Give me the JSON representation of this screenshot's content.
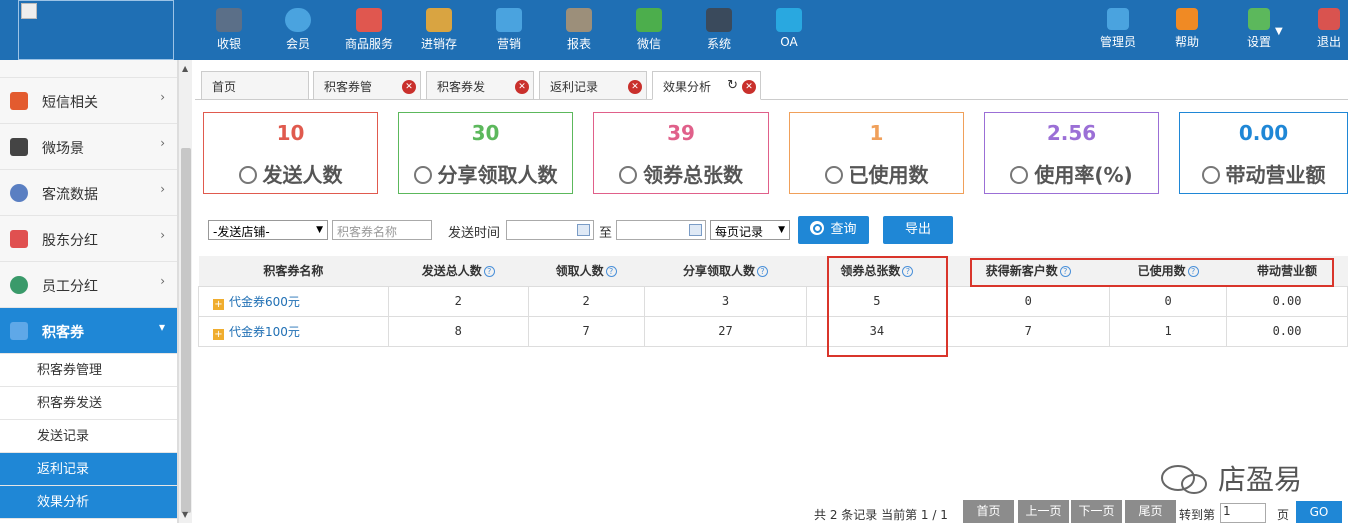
{
  "topnav": {
    "items": [
      {
        "label": "收银",
        "icon": "cash-register-icon",
        "color": "#5b6f88"
      },
      {
        "label": "会员",
        "icon": "member-icon",
        "color": "#4aa3df"
      },
      {
        "label": "商品服务",
        "icon": "goods-icon",
        "color": "#e0574f"
      },
      {
        "label": "进销存",
        "icon": "inventory-icon",
        "color": "#d9a441"
      },
      {
        "label": "营销",
        "icon": "marketing-icon",
        "color": "#4aa3df"
      },
      {
        "label": "报表",
        "icon": "report-icon",
        "color": "#9c8f7a"
      },
      {
        "label": "微信",
        "icon": "wechat-icon",
        "color": "#4cae4c"
      },
      {
        "label": "系统",
        "icon": "system-icon",
        "color": "#3a4a5c"
      },
      {
        "label": "OA",
        "icon": "oa-icon",
        "color": "#29a8e0"
      }
    ],
    "right": [
      {
        "label": "管理员",
        "icon": "admin-icon",
        "color": "#4aa3df"
      },
      {
        "label": "帮助",
        "icon": "help-icon",
        "color": "#f08a24"
      },
      {
        "label": "设置",
        "icon": "settings-icon",
        "color": "#5cb85c"
      },
      {
        "label": "退出",
        "icon": "logout-icon",
        "color": "#d9534f"
      }
    ]
  },
  "sidebar": {
    "items": [
      {
        "label": "短信相关",
        "icon": "phone-icon",
        "color": "#e35b2f"
      },
      {
        "label": "微场景",
        "icon": "mobile-icon",
        "color": "#444444"
      },
      {
        "label": "客流数据",
        "icon": "traffic-icon",
        "color": "#5a7fc2"
      },
      {
        "label": "股东分红",
        "icon": "shareholder-icon",
        "color": "#e05050"
      },
      {
        "label": "员工分红",
        "icon": "staff-icon",
        "color": "#3a9a6a"
      },
      {
        "label": "积客券",
        "icon": "coupon-icon",
        "color": "#5fa8e8"
      }
    ],
    "subitems": [
      "积客券管理",
      "积客券发送",
      "发送记录",
      "返利记录",
      "效果分析"
    ]
  },
  "tabs": [
    "首页",
    "积客券管",
    "积客券发",
    "返利记录",
    "效果分析"
  ],
  "stats": [
    {
      "value": "10",
      "label": "发送人数",
      "color": "#e05a4e"
    },
    {
      "value": "30",
      "label": "分享领取人数",
      "color": "#5cb85c"
    },
    {
      "value": "39",
      "label": "领券总张数",
      "color": "#e0608a"
    },
    {
      "value": "1",
      "label": "已使用数",
      "color": "#f0a05a"
    },
    {
      "value": "2.56",
      "label": "使用率(%)",
      "color": "#9b6fd6"
    },
    {
      "value": "0.00",
      "label": "带动营业额",
      "color": "#1f87d6"
    }
  ],
  "filters": {
    "store_select": "-发送店铺-",
    "coupon_placeholder": "积客券名称",
    "time_label": "发送时间",
    "to_label": "至",
    "page_select": "每页记录",
    "query_button": "查询",
    "export_button": "导出"
  },
  "table": {
    "headers": [
      "积客券名称",
      "发送总人数",
      "领取人数",
      "分享领取人数",
      "领券总张数",
      "获得新客户数",
      "已使用数",
      "带动营业额"
    ],
    "rows": [
      [
        "代金券600元",
        "2",
        "2",
        "3",
        "5",
        "0",
        "0",
        "0.00"
      ],
      [
        "代金券100元",
        "8",
        "7",
        "27",
        "34",
        "7",
        "1",
        "0.00"
      ]
    ]
  },
  "pager": {
    "info": "共 2 条记录 当前第 1 / 1",
    "first": "首页",
    "prev": "上一页",
    "next": "下一页",
    "last": "尾页",
    "goto": "转到第",
    "page_value": "1",
    "page_unit": "页",
    "go": "GO"
  },
  "watermark": "店盈易"
}
